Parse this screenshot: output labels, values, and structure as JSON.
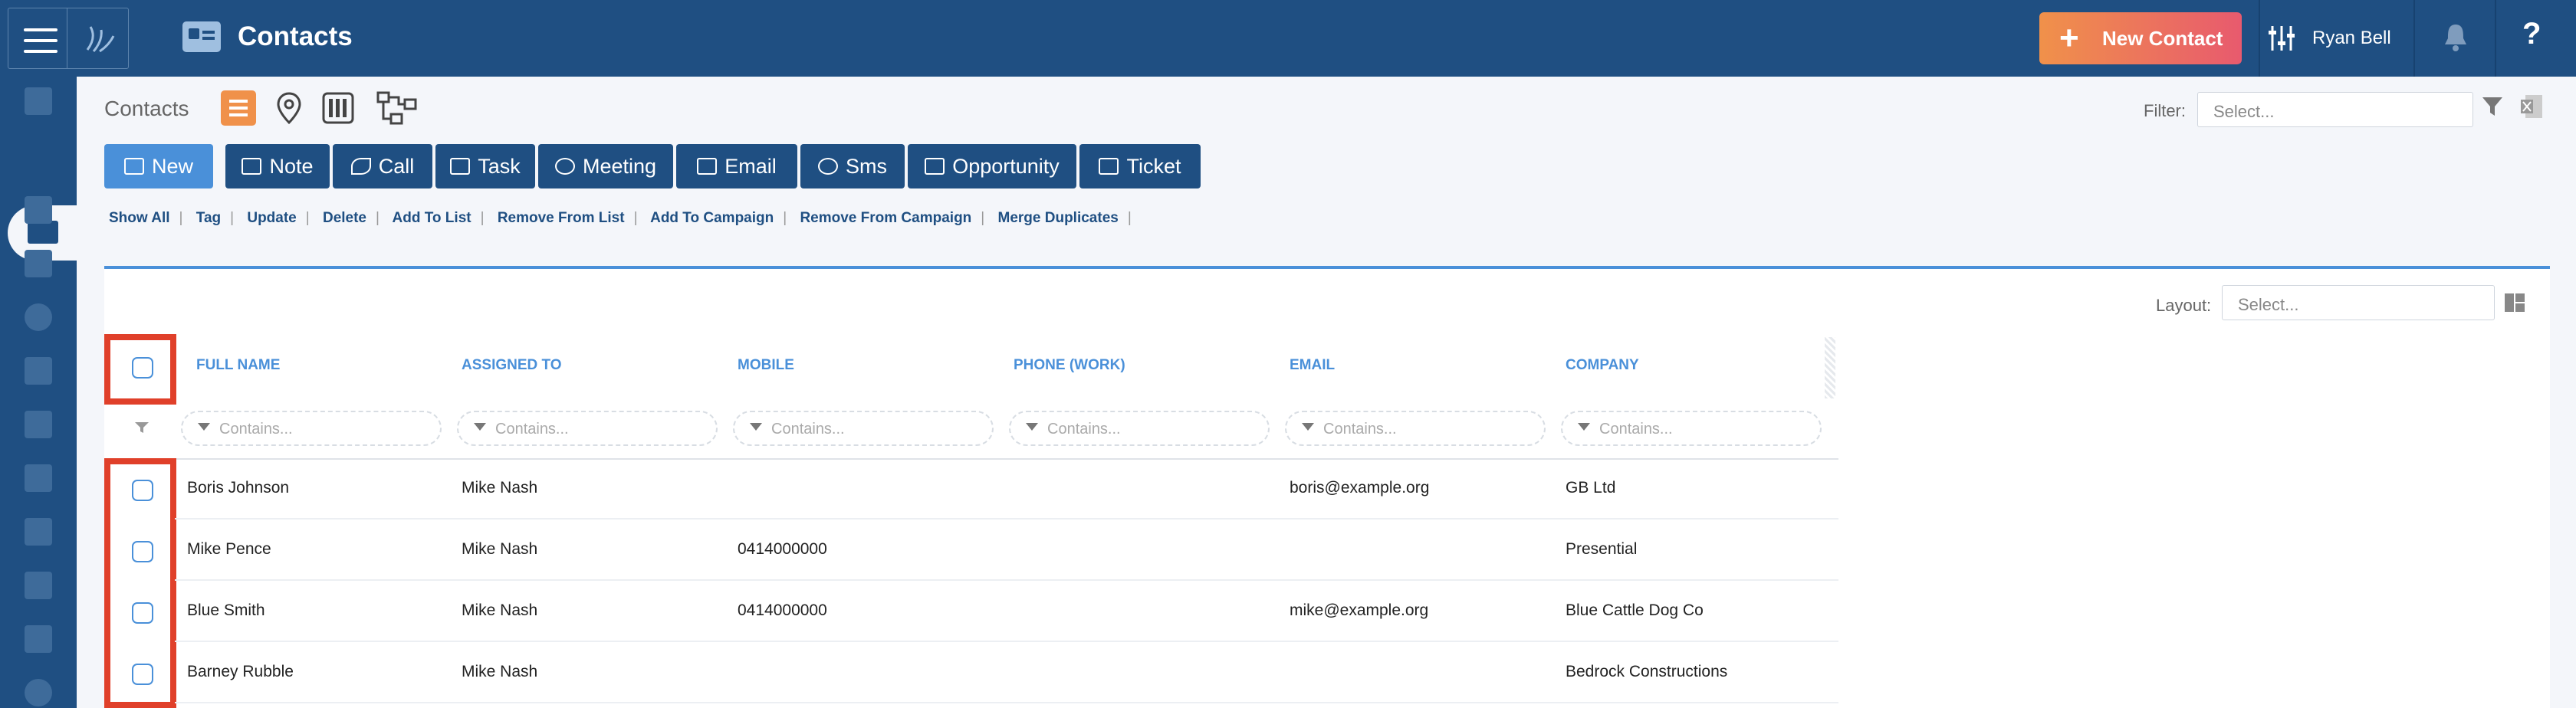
{
  "header": {
    "title": "Contacts",
    "new_contact_label": "New Contact",
    "user_name": "Ryan Bell",
    "help_glyph": "?"
  },
  "sidebar": {
    "items": [
      "building-icon",
      "contact-card-icon",
      "funnel-dollar-icon",
      "calendar-icon",
      "dollar-icon",
      "list-icon",
      "factory-icon",
      "chart-icon",
      "clipboard-icon",
      "graduation-icon",
      "report-icon",
      "gear-icon"
    ],
    "active": "contact-card-icon"
  },
  "toolbar": {
    "breadcrumb": "Contacts",
    "filter_label": "Filter:",
    "filter_placeholder": "Select...",
    "actions": [
      {
        "label": "New",
        "primary": true
      },
      {
        "label": "Note"
      },
      {
        "label": "Call"
      },
      {
        "label": "Task"
      },
      {
        "label": "Meeting"
      },
      {
        "label": "Email"
      },
      {
        "label": "Sms"
      },
      {
        "label": "Opportunity"
      },
      {
        "label": "Ticket"
      }
    ],
    "links": [
      "Show All",
      "Tag",
      "Update",
      "Delete",
      "Add To List",
      "Remove From List",
      "Add To Campaign",
      "Remove From Campaign",
      "Merge Duplicates"
    ]
  },
  "grid": {
    "layout_label": "Layout:",
    "layout_placeholder": "Select...",
    "filter_placeholder": "Contains...",
    "columns": [
      "FULL NAME",
      "ASSIGNED TO",
      "MOBILE",
      "PHONE (WORK)",
      "EMAIL",
      "COMPANY"
    ],
    "rows": [
      [
        "Boris Johnson",
        "Mike Nash",
        "",
        "",
        "boris@example.org",
        "GB Ltd"
      ],
      [
        "Mike Pence",
        "Mike Nash",
        "0414000000",
        "",
        "",
        "Presential"
      ],
      [
        "Blue Smith",
        "Mike Nash",
        "0414000000",
        "",
        "mike@example.org",
        "Blue Cattle Dog Co"
      ],
      [
        "Barney Rubble",
        "Mike Nash",
        "",
        "",
        "",
        "Bedrock Constructions"
      ]
    ]
  },
  "colors": {
    "header": "#1f4f82",
    "accent": "#4a90d9",
    "highlight": "#e0402a",
    "orange": "#f0914a"
  }
}
